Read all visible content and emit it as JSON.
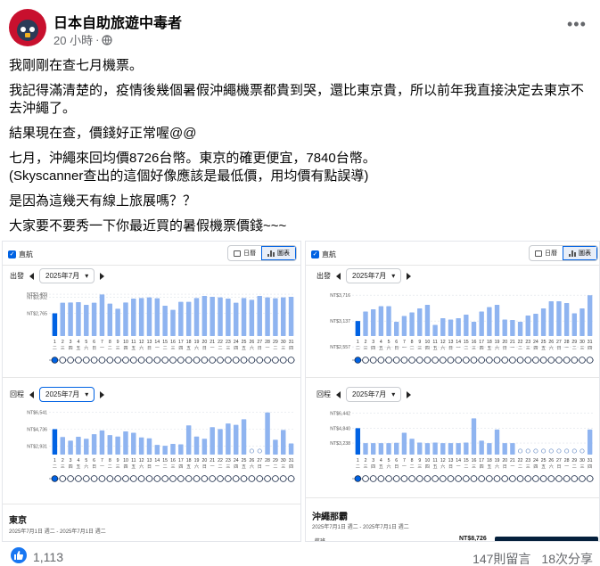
{
  "post": {
    "author": "日本自助旅遊中毒者",
    "time": "20 小時",
    "dot": "·",
    "paragraphs": [
      "我剛剛在查七月機票。",
      "我記得滿清楚的，疫情後幾個暑假沖繩機票都貴到哭，還比東京貴，所以前年我直接決定去東京不去沖繩了。",
      "結果現在查，價錢好正常喔@@",
      "七月，沖繩來回均價8726台幣。東京的確更便宜，7840台幣。",
      "(Skyscanner查出的這個好像應該是最低價，用均價有點誤導)",
      "是因為這幾天有線上旅展嗎？？",
      "大家要不要秀一下你最近買的暑假機票價錢~~~"
    ]
  },
  "icons": {
    "more": "more-icon",
    "privacy": "globe-icon",
    "reaction": "like-icon",
    "calendar": "calendar-icon",
    "bar_chart": "bar-chart-icon"
  },
  "colors": {
    "bar": "#8fb4f0",
    "bar_selected": "#0062e3",
    "accent": "#0062e3",
    "like": "#1877f2",
    "dark": "#05203c"
  },
  "screens": [
    {
      "direct_label": "直航",
      "toggle_calendar": "日曆",
      "toggle_chart": "圖表",
      "destination": "東京",
      "date_range": "2025年7月1日 週二 - 2025年7月1日 週二",
      "price_cut": "",
      "charts": [
        {
          "label": "出發",
          "month": "2025年7月",
          "focus": false,
          "chart_data": {
            "type": "bar",
            "ymin": 2000,
            "ymax": 3500,
            "yticks": [
              {
                "label": "NT$3,409",
                "value": 3409
              },
              {
                "label": "NT$3,302",
                "value": 3302
              },
              {
                "label": "NT$2,765",
                "value": 2765
              }
            ],
            "categories": [
              "1",
              "2",
              "3",
              "4",
              "5",
              "6",
              "7",
              "8",
              "9",
              "10",
              "11",
              "12",
              "13",
              "14",
              "15",
              "16",
              "17",
              "18",
              "19",
              "20",
              "21",
              "22",
              "23",
              "24",
              "25",
              "26",
              "27",
              "28",
              "29",
              "30",
              "31"
            ],
            "weekdays": [
              "二",
              "三",
              "四",
              "五",
              "六",
              "日",
              "一",
              "二",
              "三",
              "四",
              "五",
              "六",
              "日",
              "一",
              "二",
              "三",
              "四",
              "五",
              "六",
              "日",
              "一",
              "二",
              "三",
              "四",
              "五",
              "六",
              "日",
              "一",
              "二",
              "三",
              "四"
            ],
            "values": [
              2765,
              3120,
              3130,
              3140,
              3050,
              3120,
              3400,
              3090,
              2920,
              3130,
              3260,
              3280,
              3300,
              3270,
              3020,
              2880,
              3150,
              3150,
              3280,
              3350,
              3320,
              3300,
              3260,
              3120,
              3280,
              3220,
              3350,
              3300,
              3270,
              3300,
              3320
            ],
            "selected": 0,
            "muted": []
          }
        },
        {
          "label": "回程",
          "month": "2025年7月",
          "focus": true,
          "chart_data": {
            "type": "bar",
            "ymin": 2000,
            "ymax": 6800,
            "yticks": [
              {
                "label": "NT$6,541",
                "value": 6541
              },
              {
                "label": "NT$4,736",
                "value": 4736
              },
              {
                "label": "NT$2,931",
                "value": 2931
              }
            ],
            "categories": [
              "1",
              "2",
              "3",
              "4",
              "5",
              "6",
              "7",
              "8",
              "9",
              "10",
              "11",
              "12",
              "13",
              "14",
              "15",
              "16",
              "17",
              "18",
              "19",
              "20",
              "21",
              "22",
              "23",
              "24",
              "25",
              "26",
              "27",
              "28",
              "29",
              "30",
              "31"
            ],
            "weekdays": [
              "二",
              "三",
              "四",
              "五",
              "六",
              "日",
              "一",
              "二",
              "三",
              "四",
              "五",
              "六",
              "日",
              "一",
              "二",
              "三",
              "四",
              "五",
              "六",
              "日",
              "一",
              "二",
              "三",
              "四",
              "五",
              "六",
              "日",
              "一",
              "二",
              "三",
              "四"
            ],
            "values": [
              4736,
              3900,
              3500,
              3920,
              3700,
              4200,
              4600,
              4100,
              3950,
              4500,
              4350,
              3850,
              3750,
              3050,
              2950,
              3150,
              3100,
              5150,
              3950,
              3700,
              4950,
              4750,
              5350,
              5200,
              5800,
              3000,
              2931,
              6541,
              3600,
              4650,
              3200
            ],
            "selected": 0,
            "muted": [
              25,
              26
            ]
          }
        }
      ]
    },
    {
      "direct_label": "直航",
      "toggle_calendar": "日曆",
      "toggle_chart": "圖表",
      "destination": "沖繩那霸",
      "date_range": "2025年7月1日 週二 - 2025年7月1日 週二",
      "price_cut": "NT$8,726",
      "corner_text": "航班",
      "charts": [
        {
          "label": "出發",
          "month": "2025年7月",
          "focus": false,
          "chart_data": {
            "type": "bar",
            "ymin": 2800,
            "ymax": 3800,
            "yticks": [
              {
                "label": "NT$3,716",
                "value": 3716
              },
              {
                "label": "NT$3,137",
                "value": 3137
              },
              {
                "label": "NT$2,557",
                "value": 2557
              }
            ],
            "categories": [
              "1",
              "2",
              "3",
              "4",
              "5",
              "6",
              "7",
              "8",
              "9",
              "10",
              "11",
              "12",
              "13",
              "14",
              "15",
              "16",
              "17",
              "18",
              "19",
              "20",
              "21",
              "22",
              "23",
              "24",
              "25",
              "26",
              "27",
              "28",
              "29",
              "30",
              "31"
            ],
            "weekdays": [
              "二",
              "三",
              "四",
              "五",
              "六",
              "日",
              "一",
              "二",
              "三",
              "四",
              "五",
              "六",
              "日",
              "一",
              "二",
              "三",
              "四",
              "五",
              "六",
              "日",
              "一",
              "二",
              "三",
              "四",
              "五",
              "六",
              "日",
              "一",
              "二",
              "三",
              "四"
            ],
            "values": [
              3137,
              3350,
              3400,
              3470,
              3470,
              3120,
              3250,
              3330,
              3420,
              3500,
              3050,
              3200,
              3170,
              3200,
              3280,
              3120,
              3350,
              3450,
              3500,
              3170,
              3160,
              3120,
              3260,
              3300,
              3420,
              3580,
              3580,
              3540,
              3310,
              3420,
              3716
            ],
            "selected": 0,
            "muted": []
          }
        },
        {
          "label": "回程",
          "month": "2025年7月",
          "focus": false,
          "chart_data": {
            "type": "bar",
            "ymin": 2000,
            "ymax": 6800,
            "yticks": [
              {
                "label": "NT$6,442",
                "value": 6442
              },
              {
                "label": "NT$4,840",
                "value": 4840
              },
              {
                "label": "NT$3,238",
                "value": 3238
              }
            ],
            "categories": [
              "1",
              "2",
              "3",
              "4",
              "5",
              "6",
              "7",
              "8",
              "9",
              "10",
              "11",
              "12",
              "13",
              "14",
              "15",
              "16",
              "17",
              "18",
              "19",
              "20",
              "21",
              "22",
              "23",
              "24",
              "25",
              "26",
              "27",
              "28",
              "29",
              "30",
              "31"
            ],
            "weekdays": [
              "二",
              "三",
              "四",
              "五",
              "六",
              "日",
              "一",
              "二",
              "三",
              "四",
              "五",
              "六",
              "日",
              "一",
              "二",
              "三",
              "四",
              "五",
              "六",
              "日",
              "一",
              "二",
              "三",
              "四",
              "五",
              "六",
              "日",
              "一",
              "二",
              "三",
              "四"
            ],
            "values": [
              4840,
              3238,
              3238,
              3238,
              3238,
              3270,
              4350,
              3700,
              3300,
              3238,
              3300,
              3238,
              3238,
              3238,
              3300,
              5900,
              3500,
              3238,
              4700,
              3238,
              3238,
              5250,
              6000,
              4300,
              5700,
              3400,
              3300,
              3100,
              3050,
              3000,
              4700
            ],
            "selected": 0,
            "muted": [
              21,
              22,
              23,
              24,
              25,
              26,
              27,
              28,
              29
            ]
          }
        }
      ]
    }
  ],
  "footer": {
    "likes": "1,113",
    "comments": "147則留言",
    "shares": "18次分享"
  }
}
